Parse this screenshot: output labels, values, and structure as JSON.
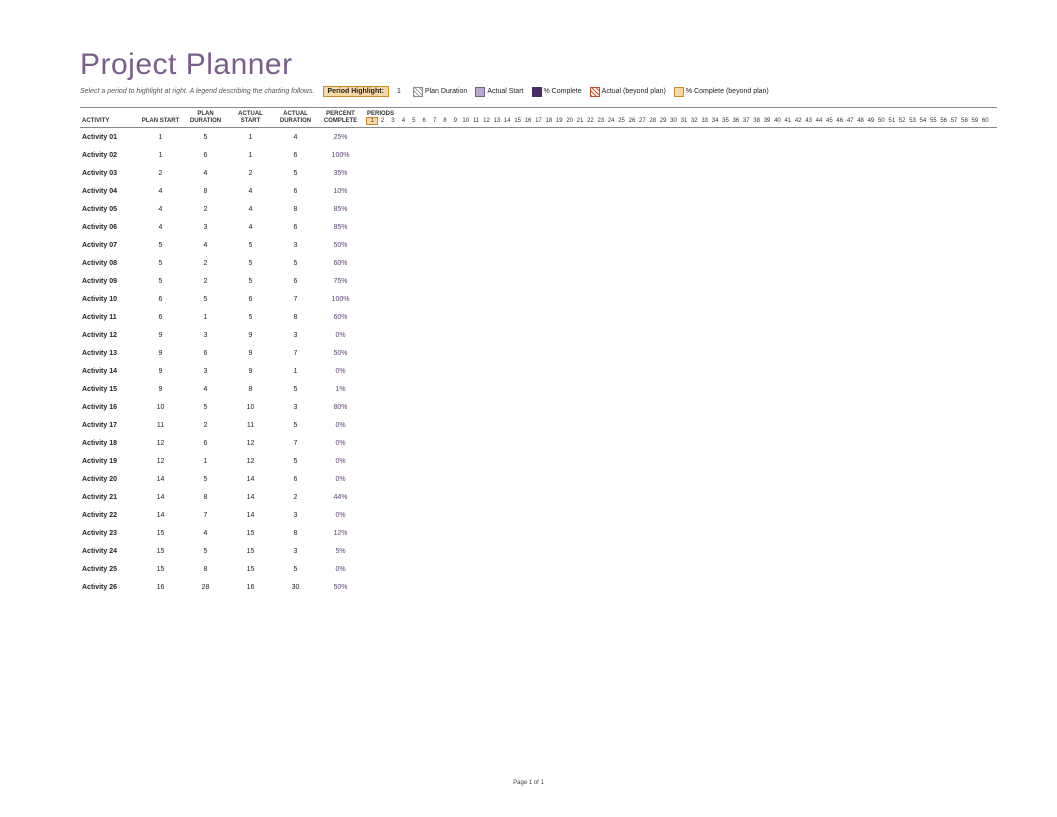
{
  "title": "Project Planner",
  "instruction": "Select a period to highlight at right. A legend describing the charting follows.",
  "periodHighlightLabel": "Period Highlight:",
  "periodHighlightValue": "1",
  "legend": {
    "planDuration": "Plan Duration",
    "actualStart": "Actual Start",
    "percentComplete": "% Complete",
    "actualBeyond": "Actual (beyond plan)",
    "completeBeyond": "% Complete (beyond plan)"
  },
  "columns": {
    "activity": "ACTIVITY",
    "planStart": "PLAN START",
    "planDuration": "PLAN DURATION",
    "actualStart": "ACTUAL START",
    "actualDuration": "ACTUAL DURATION",
    "percentComplete": "PERCENT COMPLETE",
    "periods": "PERIODS"
  },
  "periodsCount": 60,
  "highlightPeriod": 1,
  "rows": [
    {
      "activity": "Activity 01",
      "planStart": "1",
      "planDuration": "5",
      "actualStart": "1",
      "actualDuration": "4",
      "percent": "25%"
    },
    {
      "activity": "Activity 02",
      "planStart": "1",
      "planDuration": "6",
      "actualStart": "1",
      "actualDuration": "6",
      "percent": "100%"
    },
    {
      "activity": "Activity 03",
      "planStart": "2",
      "planDuration": "4",
      "actualStart": "2",
      "actualDuration": "5",
      "percent": "35%"
    },
    {
      "activity": "Activity 04",
      "planStart": "4",
      "planDuration": "8",
      "actualStart": "4",
      "actualDuration": "6",
      "percent": "10%"
    },
    {
      "activity": "Activity 05",
      "planStart": "4",
      "planDuration": "2",
      "actualStart": "4",
      "actualDuration": "8",
      "percent": "85%"
    },
    {
      "activity": "Activity 06",
      "planStart": "4",
      "planDuration": "3",
      "actualStart": "4",
      "actualDuration": "6",
      "percent": "85%"
    },
    {
      "activity": "Activity 07",
      "planStart": "5",
      "planDuration": "4",
      "actualStart": "5",
      "actualDuration": "3",
      "percent": "50%"
    },
    {
      "activity": "Activity 08",
      "planStart": "5",
      "planDuration": "2",
      "actualStart": "5",
      "actualDuration": "5",
      "percent": "60%"
    },
    {
      "activity": "Activity 09",
      "planStart": "5",
      "planDuration": "2",
      "actualStart": "5",
      "actualDuration": "6",
      "percent": "75%"
    },
    {
      "activity": "Activity 10",
      "planStart": "6",
      "planDuration": "5",
      "actualStart": "6",
      "actualDuration": "7",
      "percent": "100%"
    },
    {
      "activity": "Activity 11",
      "planStart": "6",
      "planDuration": "1",
      "actualStart": "5",
      "actualDuration": "8",
      "percent": "60%"
    },
    {
      "activity": "Activity 12",
      "planStart": "9",
      "planDuration": "3",
      "actualStart": "9",
      "actualDuration": "3",
      "percent": "0%"
    },
    {
      "activity": "Activity 13",
      "planStart": "9",
      "planDuration": "6",
      "actualStart": "9",
      "actualDuration": "7",
      "percent": "50%"
    },
    {
      "activity": "Activity 14",
      "planStart": "9",
      "planDuration": "3",
      "actualStart": "9",
      "actualDuration": "1",
      "percent": "0%"
    },
    {
      "activity": "Activity 15",
      "planStart": "9",
      "planDuration": "4",
      "actualStart": "8",
      "actualDuration": "5",
      "percent": "1%"
    },
    {
      "activity": "Activity 16",
      "planStart": "10",
      "planDuration": "5",
      "actualStart": "10",
      "actualDuration": "3",
      "percent": "80%"
    },
    {
      "activity": "Activity 17",
      "planStart": "11",
      "planDuration": "2",
      "actualStart": "11",
      "actualDuration": "5",
      "percent": "0%"
    },
    {
      "activity": "Activity 18",
      "planStart": "12",
      "planDuration": "6",
      "actualStart": "12",
      "actualDuration": "7",
      "percent": "0%"
    },
    {
      "activity": "Activity 19",
      "planStart": "12",
      "planDuration": "1",
      "actualStart": "12",
      "actualDuration": "5",
      "percent": "0%"
    },
    {
      "activity": "Activity 20",
      "planStart": "14",
      "planDuration": "5",
      "actualStart": "14",
      "actualDuration": "6",
      "percent": "0%"
    },
    {
      "activity": "Activity 21",
      "planStart": "14",
      "planDuration": "8",
      "actualStart": "14",
      "actualDuration": "2",
      "percent": "44%"
    },
    {
      "activity": "Activity 22",
      "planStart": "14",
      "planDuration": "7",
      "actualStart": "14",
      "actualDuration": "3",
      "percent": "0%"
    },
    {
      "activity": "Activity 23",
      "planStart": "15",
      "planDuration": "4",
      "actualStart": "15",
      "actualDuration": "8",
      "percent": "12%"
    },
    {
      "activity": "Activity 24",
      "planStart": "15",
      "planDuration": "5",
      "actualStart": "15",
      "actualDuration": "3",
      "percent": "5%"
    },
    {
      "activity": "Activity 25",
      "planStart": "15",
      "planDuration": "8",
      "actualStart": "15",
      "actualDuration": "5",
      "percent": "0%"
    },
    {
      "activity": "Activity 26",
      "planStart": "16",
      "planDuration": "28",
      "actualStart": "16",
      "actualDuration": "30",
      "percent": "50%"
    }
  ],
  "footer": "Page 1 of 1"
}
